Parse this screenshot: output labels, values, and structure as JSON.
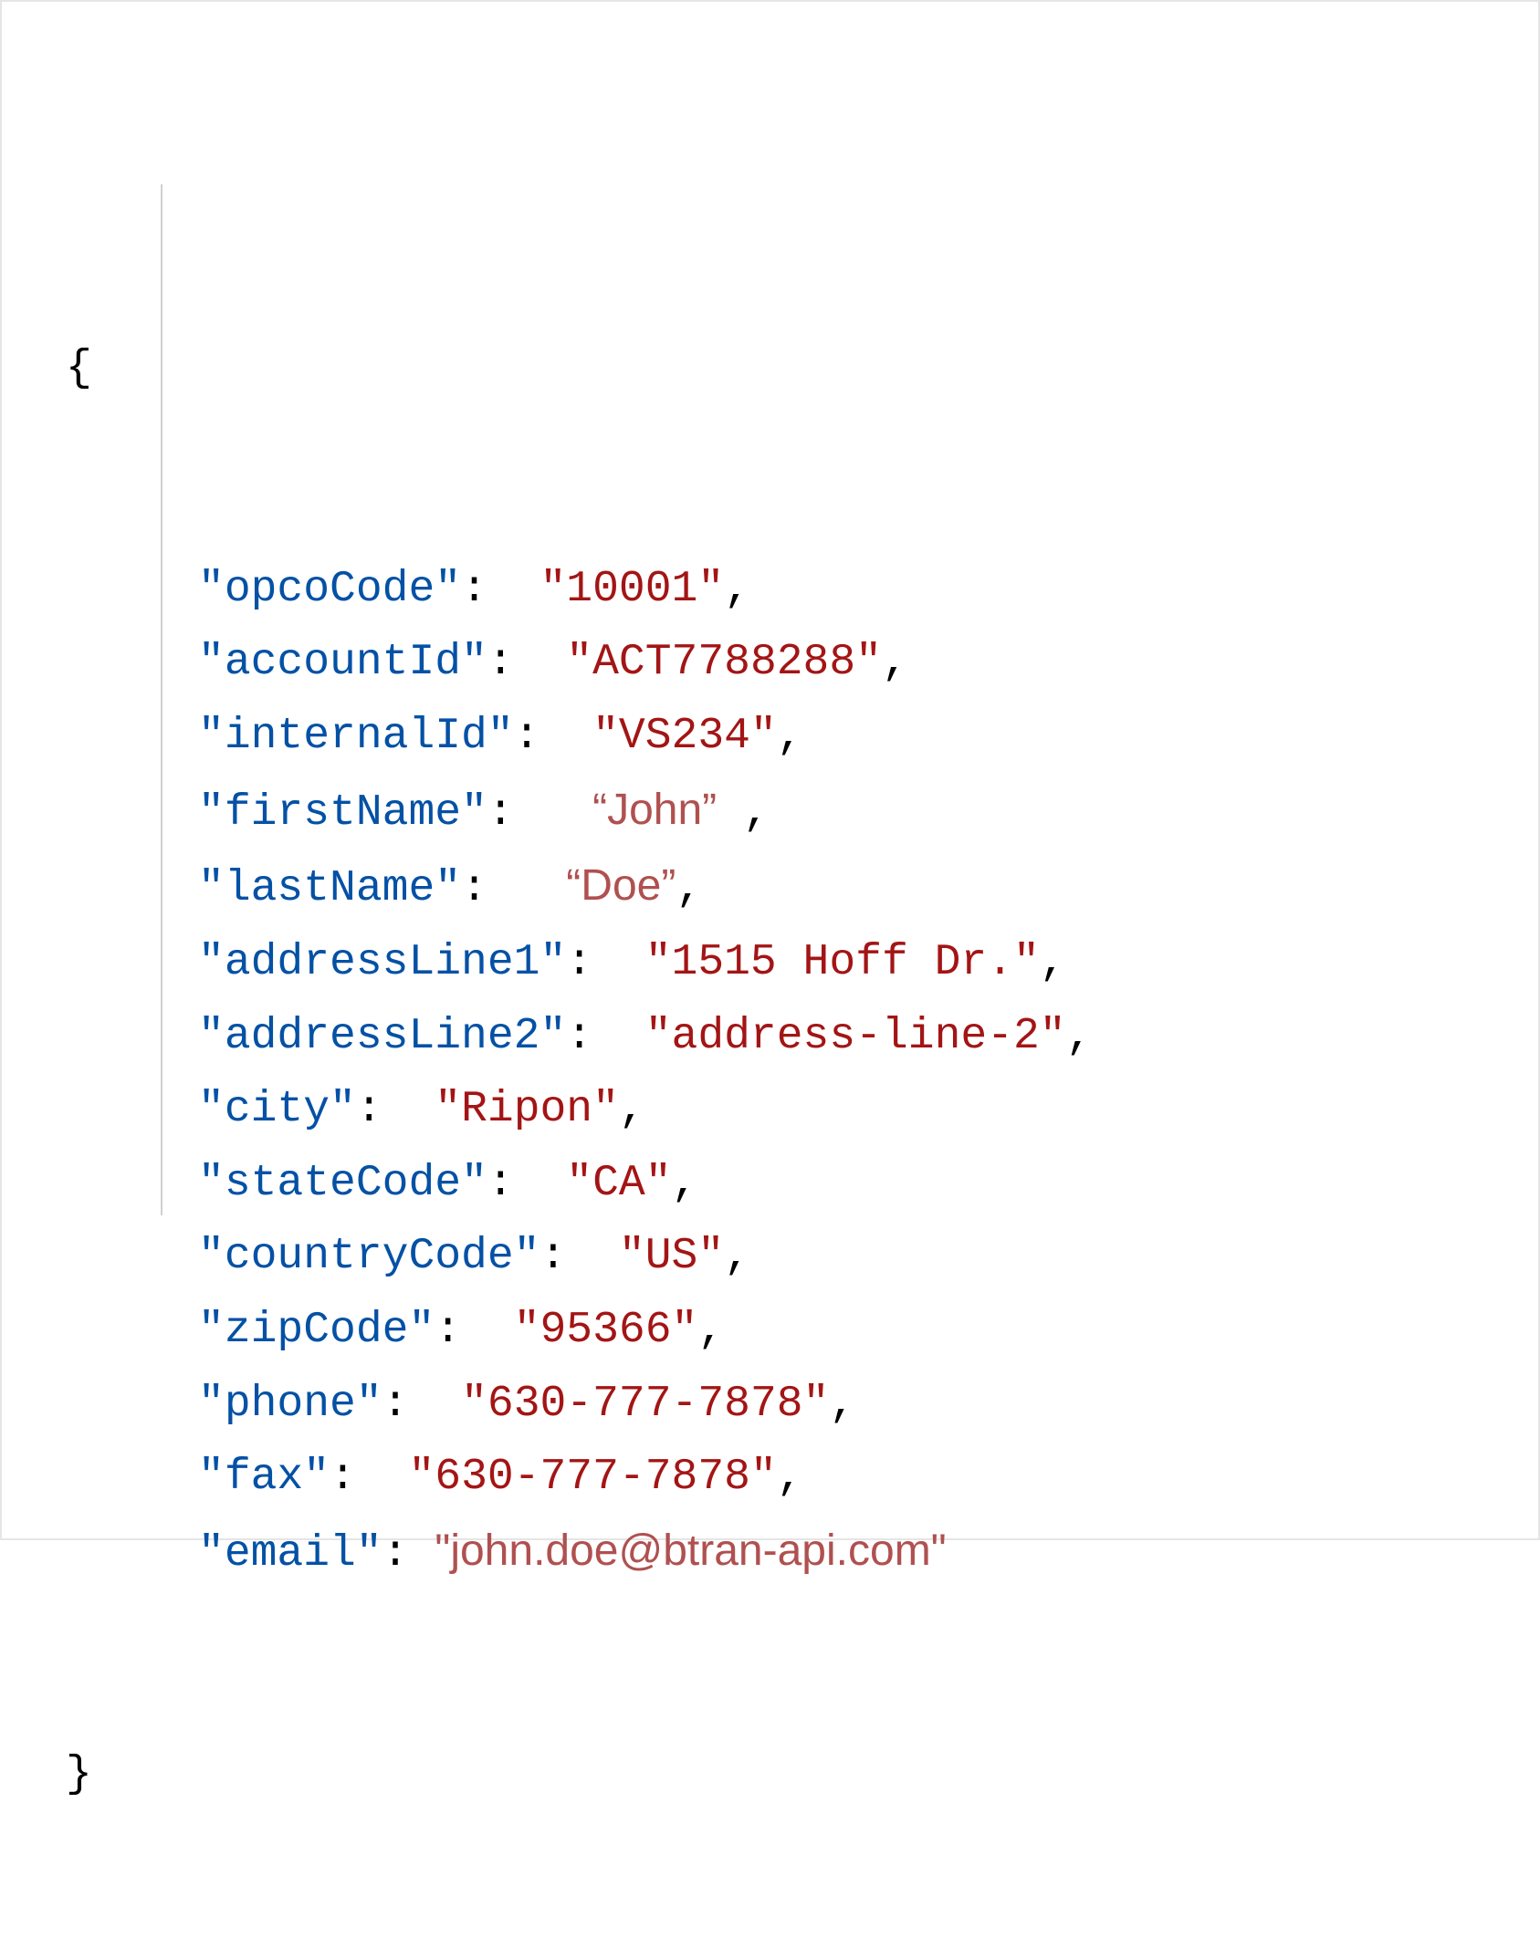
{
  "json": {
    "entries": [
      {
        "key": "opcoCode",
        "value": "10001",
        "variant": "mono",
        "trailingComma": true
      },
      {
        "key": "accountId",
        "value": "ACT7788288",
        "variant": "mono",
        "trailingComma": true
      },
      {
        "key": "internalId",
        "value": "VS234",
        "variant": "mono",
        "trailingComma": true
      },
      {
        "key": "firstName",
        "value": "John",
        "variant": "curly",
        "trailingComma": true,
        "spaceBeforeComma": true
      },
      {
        "key": "lastName",
        "value": "Doe",
        "variant": "curly",
        "trailingComma": true
      },
      {
        "key": "addressLine1",
        "value": "1515 Hoff Dr.",
        "variant": "mono",
        "trailingComma": true
      },
      {
        "key": "addressLine2",
        "value": "address-line-2",
        "variant": "mono",
        "trailingComma": true
      },
      {
        "key": "city",
        "value": "Ripon",
        "variant": "mono",
        "trailingComma": true
      },
      {
        "key": "stateCode",
        "value": "CA",
        "variant": "mono",
        "trailingComma": true
      },
      {
        "key": "countryCode",
        "value": "US",
        "variant": "mono",
        "trailingComma": true
      },
      {
        "key": "zipCode",
        "value": "95366",
        "variant": "mono",
        "trailingComma": true
      },
      {
        "key": "phone",
        "value": "630-777-7878",
        "variant": "mono",
        "trailingComma": true
      },
      {
        "key": "fax",
        "value": "630-777-7878",
        "variant": "mono",
        "trailingComma": true
      },
      {
        "key": "email",
        "value": "john.doe@btran-api.com",
        "variant": "sans",
        "trailingComma": false,
        "tightColon": true
      }
    ],
    "openBrace": "{",
    "closeBrace": "}"
  }
}
